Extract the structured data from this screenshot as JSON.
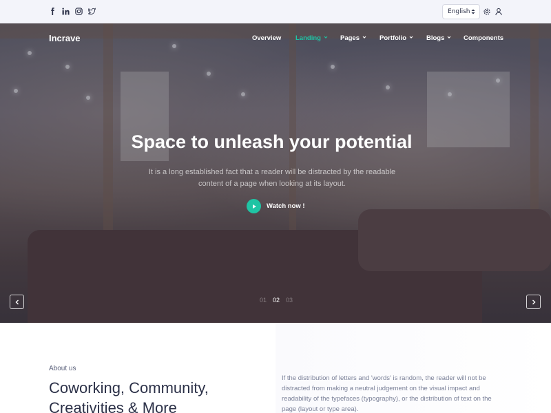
{
  "topbar": {
    "social_icons": [
      "facebook-icon",
      "linkedin-icon",
      "instagram-icon",
      "twitter-icon"
    ],
    "language": {
      "selected": "English"
    },
    "icons": [
      "gear-icon",
      "user-icon"
    ]
  },
  "brand": {
    "name": "Incrave"
  },
  "nav": {
    "items": [
      {
        "label": "Overview",
        "dropdown": false,
        "active": false
      },
      {
        "label": "Landing",
        "dropdown": true,
        "active": true
      },
      {
        "label": "Pages",
        "dropdown": true,
        "active": false
      },
      {
        "label": "Portfolio",
        "dropdown": true,
        "active": false
      },
      {
        "label": "Blogs",
        "dropdown": true,
        "active": false
      },
      {
        "label": "Components",
        "dropdown": false,
        "active": false
      }
    ]
  },
  "hero": {
    "title": "Space to unleash your potential",
    "subtitle": "It is a long established fact that a reader will be distracted by the readable content of a page when looking at its layout.",
    "watch_label": "Watch now !",
    "slides": [
      "01",
      "02",
      "03"
    ],
    "current_slide": "02"
  },
  "about": {
    "label": "About us",
    "title": "Coworking, Community, Creativities & More",
    "text": "If the distribution of letters and 'words' is random, the reader will not be distracted from making a neutral judgement on the visual impact and readability of the typefaces (typography), or the distribution of text on the page (layout or type area)."
  },
  "colors": {
    "accent": "#1fc4a4",
    "topbar_bg": "#f3f4fa",
    "heading": "#2c3148",
    "body_text": "#7a8098"
  }
}
